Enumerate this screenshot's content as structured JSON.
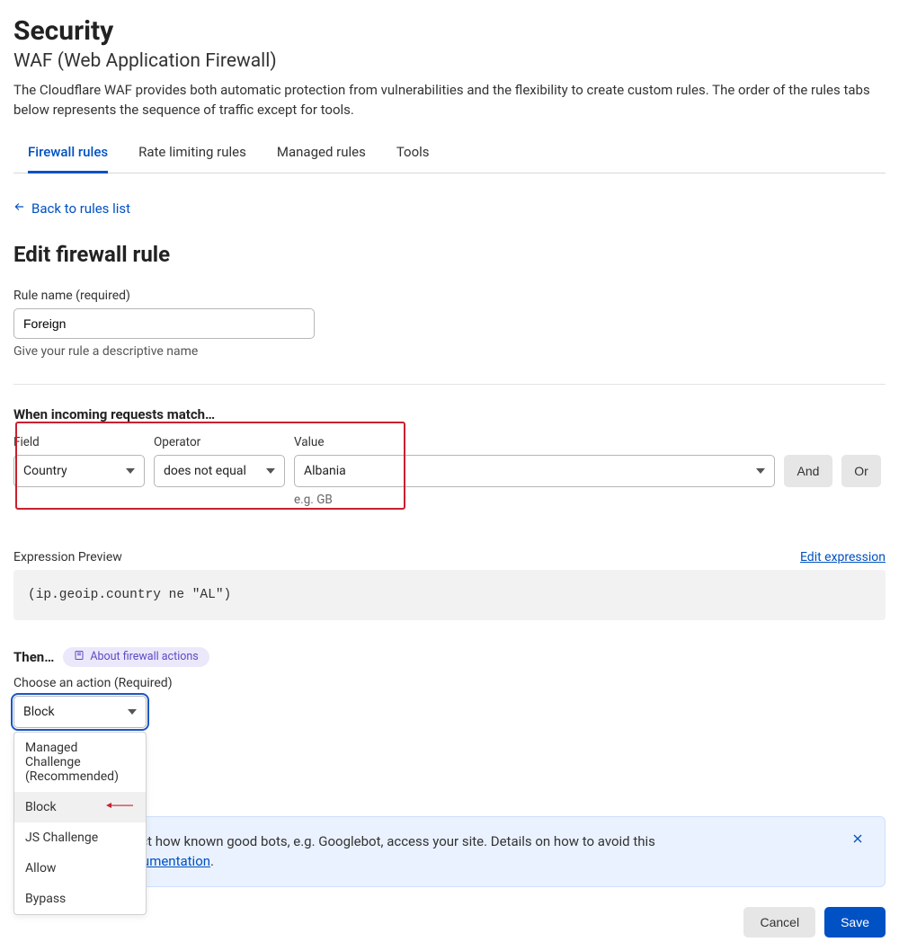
{
  "header": {
    "title": "Security",
    "subtitle": "WAF (Web Application Firewall)",
    "description": "The Cloudflare WAF provides both automatic protection from vulnerabilities and the flexibility to create custom rules. The order of the rules tabs below represents the sequence of traffic except for tools."
  },
  "tabs": [
    {
      "label": "Firewall rules",
      "active": true
    },
    {
      "label": "Rate limiting rules",
      "active": false
    },
    {
      "label": "Managed rules",
      "active": false
    },
    {
      "label": "Tools",
      "active": false
    }
  ],
  "backlink": "Back to rules list",
  "edit": {
    "heading": "Edit firewall rule",
    "rule_name_label": "Rule name (required)",
    "rule_name_value": "Foreign",
    "rule_name_help": "Give your rule a descriptive name"
  },
  "match": {
    "heading": "When incoming requests match…",
    "field_label": "Field",
    "operator_label": "Operator",
    "value_label": "Value",
    "field_value": "Country",
    "operator_value": "does not equal",
    "value_value": "Albania",
    "example": "e.g. GB",
    "and_label": "And",
    "or_label": "Or"
  },
  "expression": {
    "label": "Expression Preview",
    "edit_link": "Edit expression",
    "code": "(ip.geoip.country ne \"AL\")"
  },
  "then": {
    "heading": "Then…",
    "about_label": "About firewall actions",
    "choose_label": "Choose an action (Required)",
    "selected": "Block",
    "options": [
      "Managed Challenge (Recommended)",
      "Block",
      "JS Challenge",
      "Allow",
      "Bypass"
    ]
  },
  "notice": {
    "text_suffix": "essions could affect how known good bots, e.g. Googlebot, access your site. Details on how to avoid this ",
    "text_after_colon": ": ",
    "link": "Firewall rules documentation",
    "period": "."
  },
  "footer": {
    "cancel": "Cancel",
    "save": "Save"
  }
}
